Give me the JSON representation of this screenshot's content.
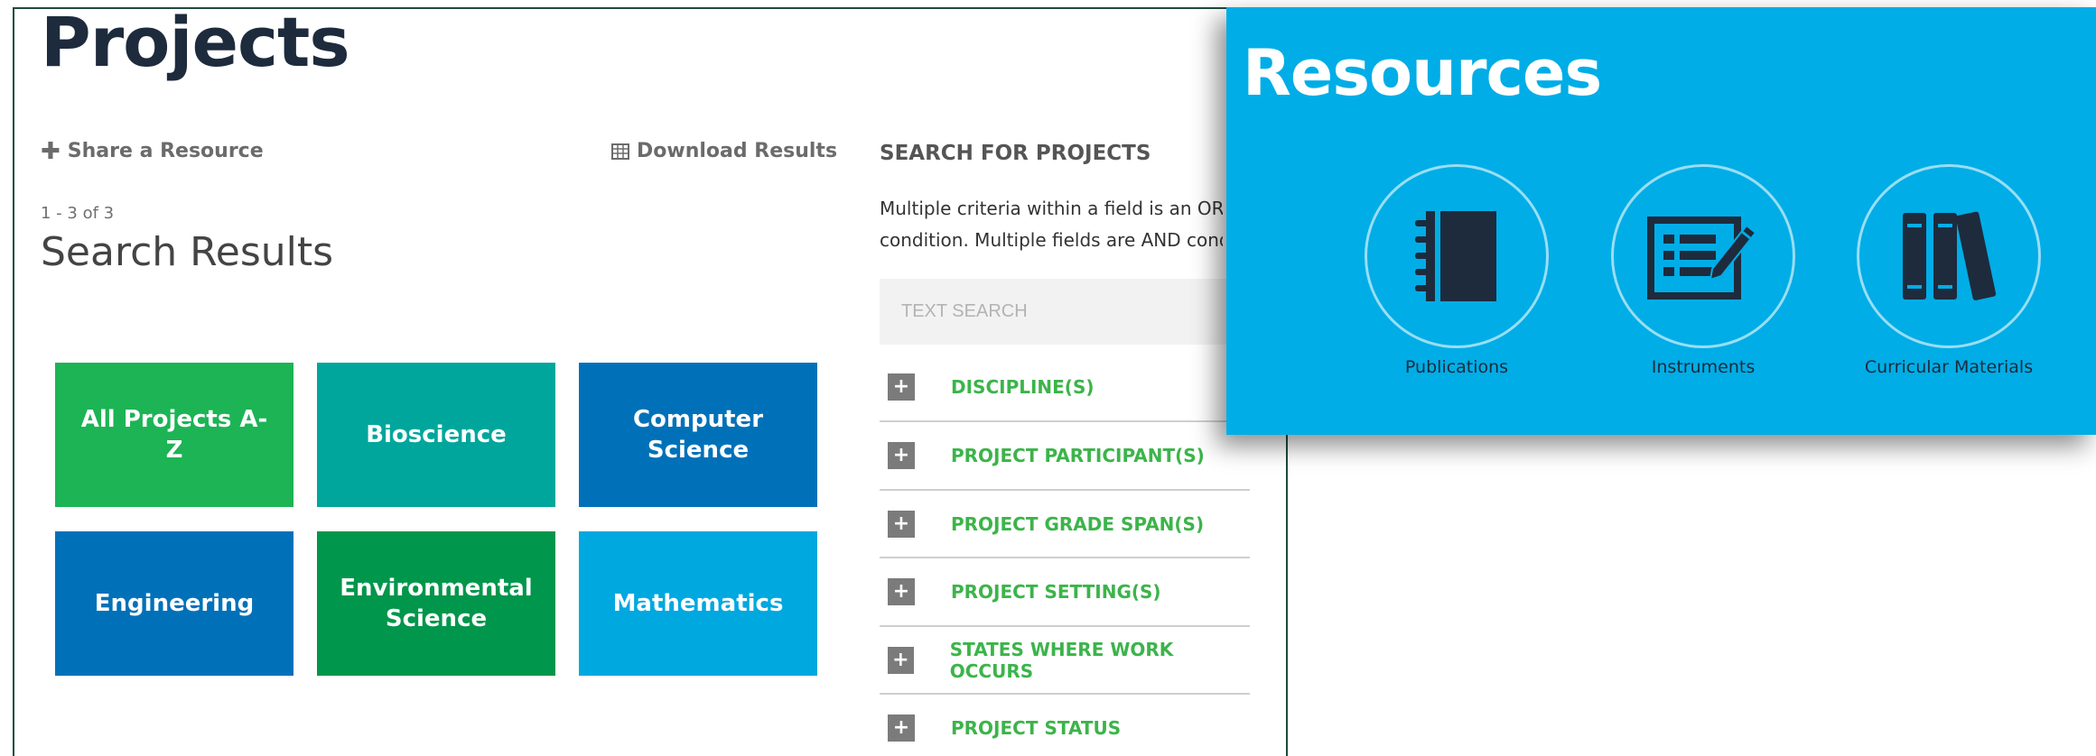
{
  "page": {
    "title": "Projects",
    "share_label": "Share a Resource",
    "download_label": "Download Results",
    "result_count": "1 - 3 of 3",
    "results_heading": "Search Results"
  },
  "tiles": [
    {
      "label": "All Projects A-Z",
      "color": "#1cb455"
    },
    {
      "label": "Bioscience",
      "color": "#00a69c"
    },
    {
      "label": "Computer Science",
      "color": "#0071b9"
    },
    {
      "label": "Engineering",
      "color": "#0071b9"
    },
    {
      "label": "Environmental Science",
      "color": "#00964b"
    },
    {
      "label": "Mathematics",
      "color": "#00a8e0"
    }
  ],
  "search": {
    "heading": "SEARCH FOR PROJECTS",
    "desc_line1": "Multiple criteria within a field is an OR",
    "desc_line2": "condition. Multiple fields are AND cond",
    "placeholder": "TEXT SEARCH",
    "filters": [
      "DISCIPLINE(S)",
      "PROJECT PARTICIPANT(S)",
      "PROJECT GRADE SPAN(S)",
      "PROJECT SETTING(S)",
      "STATES WHERE WORK OCCURS",
      "PROJECT STATUS"
    ]
  },
  "resources": {
    "title": "Resources",
    "background": "#00ade6",
    "items": [
      {
        "label": "Publications",
        "icon": "notebook-icon"
      },
      {
        "label": "Instruments",
        "icon": "checklist-pencil-icon"
      },
      {
        "label": "Curricular Materials",
        "icon": "books-icon"
      }
    ]
  }
}
